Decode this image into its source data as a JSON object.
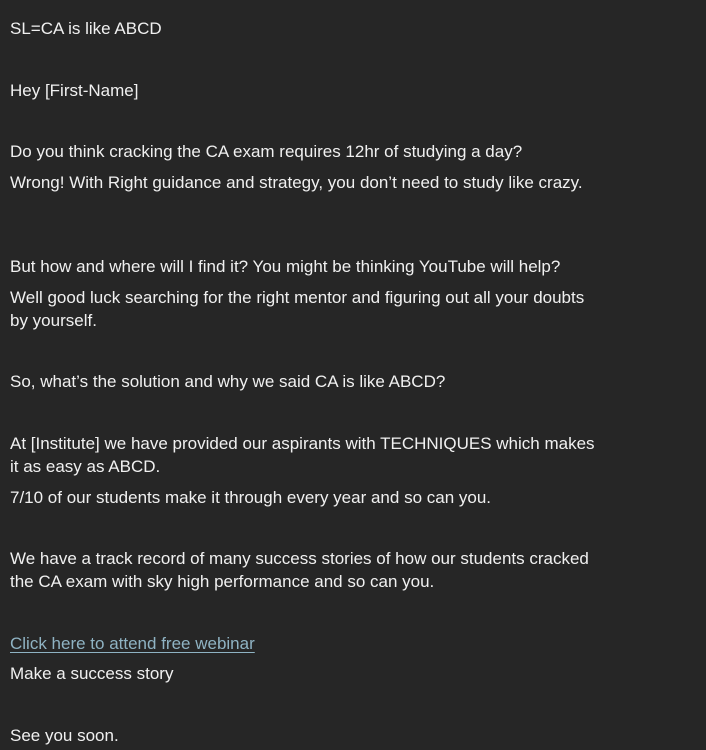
{
  "email": {
    "subject_line": "SL=CA is like ABCD",
    "greeting": "Hey [First-Name]",
    "question": "Do you think cracking the CA exam requires 12hr of studying a day?",
    "answer": "Wrong! With Right guidance and strategy, you don’t need to study like crazy.",
    "youtube_question": "But how and where will I find it? You might be thinking YouTube will help?",
    "mentor_text": "Well good luck searching for the right mentor and figuring out all your doubts by yourself.",
    "solution_question": "So, what’s the solution and why we said CA is like ABCD?",
    "institute_text": "At [Institute] we have provided our aspirants with TECHNIQUES which makes it as easy as ABCD.",
    "stat_text": "7/10 of our students make it through every year and so can you.",
    "track_record": "We have a track record of many success stories of how our students cracked the CA exam with sky high performance and so can you.",
    "webinar_link": "Click here to attend free webinar",
    "success_line": "Make a success story",
    "signoff": "See you soon."
  }
}
